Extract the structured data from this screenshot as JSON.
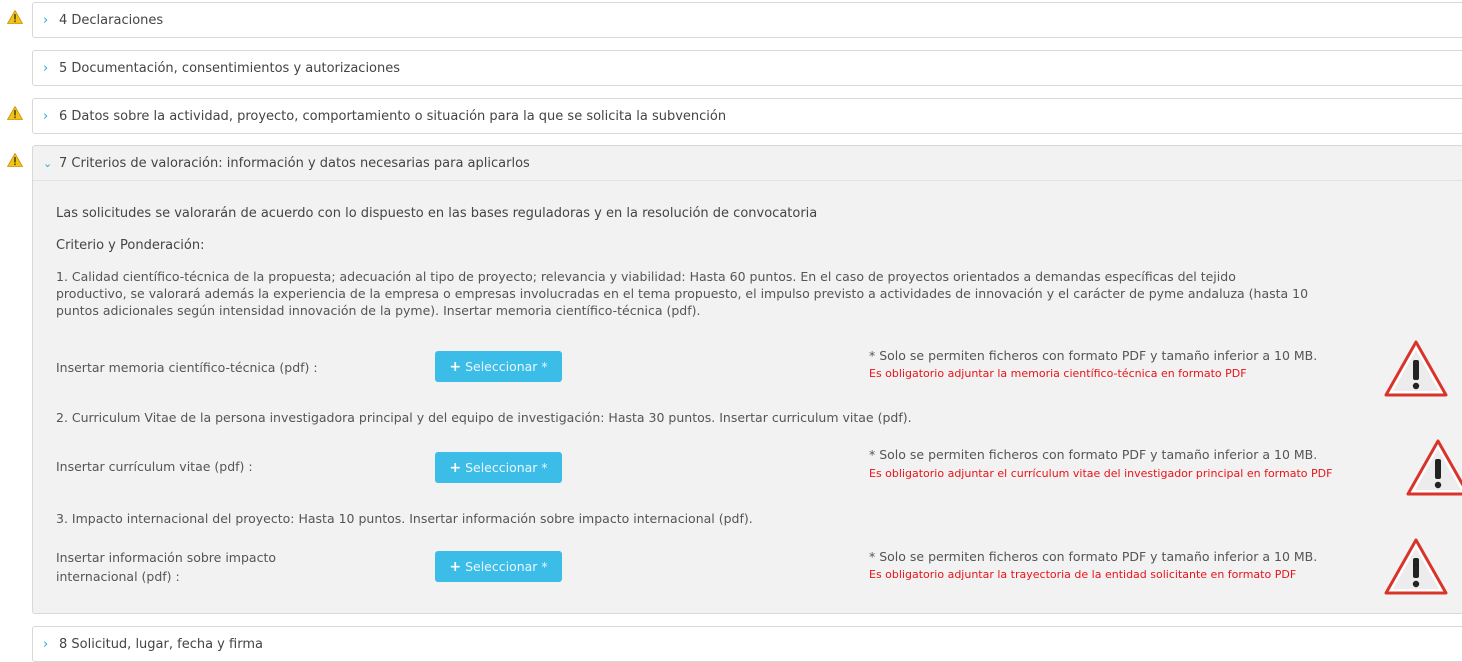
{
  "sections": [
    {
      "label": "4 Declaraciones",
      "warning": true,
      "open": false
    },
    {
      "label": "5 Documentación, consentimientos y autorizaciones",
      "warning": false,
      "open": false
    },
    {
      "label": "6 Datos sobre la actividad, proyecto, comportamiento o situación para la que se solicita la subvención",
      "warning": true,
      "open": false
    },
    {
      "label": "7 Criterios de valoración: información y datos necesarias para aplicarlos",
      "warning": true,
      "open": true
    },
    {
      "label": "8 Solicitud, lugar, fecha y firma",
      "warning": false,
      "open": false
    }
  ],
  "criteria": {
    "intro": "Las solicitudes se valorarán de acuerdo con lo dispuesto en las bases reguladoras y en la resolución de convocatoria",
    "heading": "Criterio y Ponderación:",
    "item1_line1": "1. Calidad científico-técnica de la propuesta; adecuación al tipo de proyecto; relevancia y viabilidad: Hasta 60 puntos. En el caso de proyectos orientados a demandas específicas del tejido",
    "item1_line2": "productivo, se valorará además la experiencia de la empresa o empresas involucradas en el tema propuesto, el impulso previsto a actividades de innovación y el carácter de pyme andaluza (hasta 10",
    "item1_line3": "puntos adicionales según intensidad innovación de la pyme). Insertar memoria científico-técnica (pdf).",
    "item2": "2. Curriculum Vitae de la persona investigadora principal y del equipo de investigación: Hasta 30 puntos. Insertar curriculum vitae (pdf).",
    "item3": "3. Impacto internacional del proyecto: Hasta 10 puntos. Insertar información sobre impacto internacional (pdf).",
    "uploads": [
      {
        "label": "Insertar memoria científico-técnica (pdf) :",
        "button": "Seleccionar *",
        "note": "* Solo se permiten ficheros con formato PDF y tamaño inferior a 10 MB.",
        "error": "Es obligatorio adjuntar la memoria científico-técnica en formato PDF"
      },
      {
        "label": "Insertar currículum vitae (pdf) :",
        "button": "Seleccionar *",
        "note": "* Solo se permiten ficheros con formato PDF y tamaño inferior a 10 MB.",
        "error": "Es obligatorio adjuntar el currículum vitae del investigador principal en formato PDF"
      },
      {
        "label_line1": "Insertar información sobre impacto",
        "label_line2": "internacional (pdf) :",
        "button": "Seleccionar *",
        "note": "* Solo se permiten ficheros con formato PDF y tamaño inferior a 10 MB.",
        "error": "Es obligatorio adjuntar la trayectoria de la entidad solicitante en formato PDF"
      }
    ]
  },
  "icons": {
    "collapsed": "chevron-right-icon",
    "expanded": "chevron-down-icon",
    "small_warning": "warning-icon",
    "large_warning": "warning-triangle-icon",
    "add": "plus-icon"
  },
  "colors": {
    "accent": "#29a8dc",
    "button": "#3bbde8",
    "error": "#e8141a",
    "warning_fill": "#f2c21b",
    "warning_border": "#d9342b",
    "panel_open_bg": "#f2f2f2"
  }
}
